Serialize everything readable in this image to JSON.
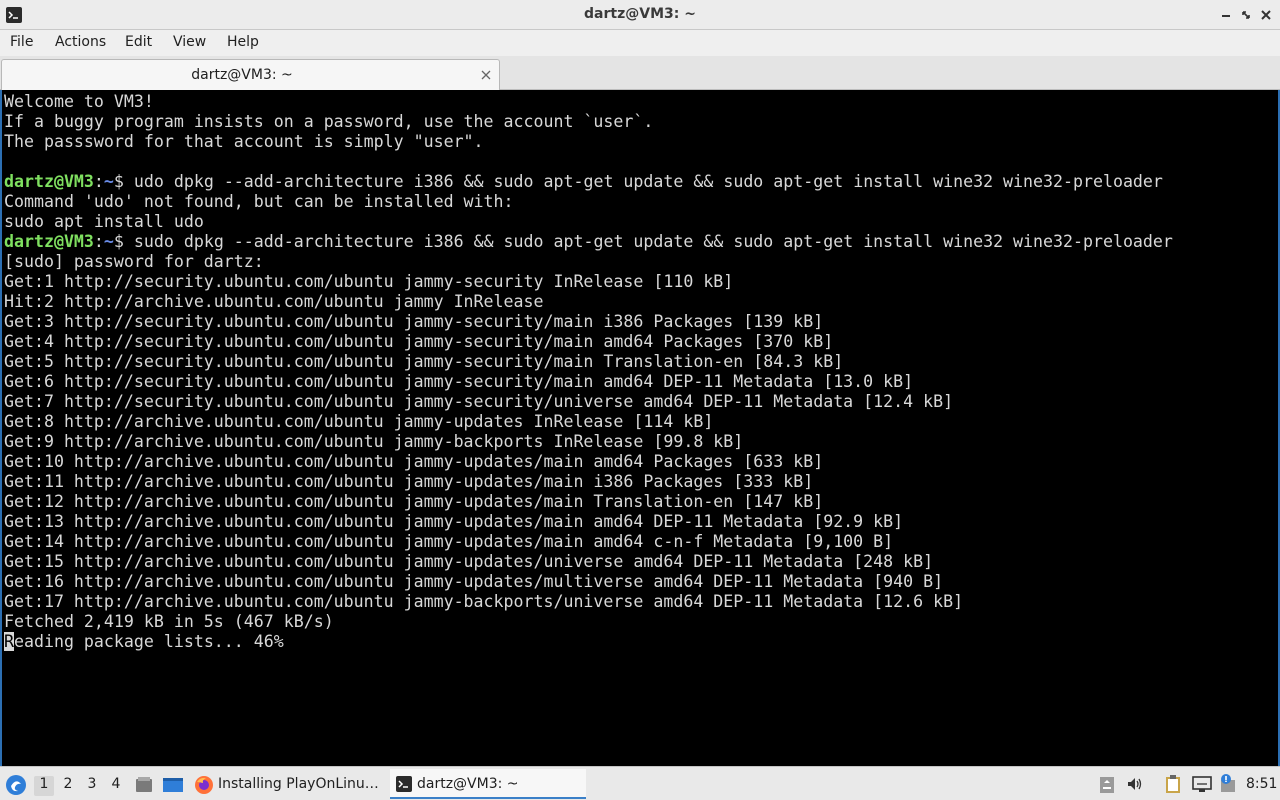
{
  "window": {
    "title": "dartz@VM3: ~",
    "icon": "terminal-icon"
  },
  "menu": {
    "items": [
      "File",
      "Actions",
      "Edit",
      "View",
      "Help"
    ]
  },
  "tabs": [
    {
      "label": "dartz@VM3: ~",
      "close_icon": "close-icon"
    }
  ],
  "terminal": {
    "prompt_user": "dartz@VM3",
    "prompt_sep": ":",
    "prompt_path": "~",
    "prompt_suffix": "$ ",
    "lines": [
      {
        "text": "Welcome to VM3!"
      },
      {
        "text": "If a buggy program insists on a password, use the account `user`."
      },
      {
        "text": "The passsword for that account is simply \"user\"."
      },
      {
        "text": ""
      },
      {
        "prompt": true,
        "text": "udo dpkg --add-architecture i386 && sudo apt-get update && sudo apt-get install wine32 wine32-preloader"
      },
      {
        "text": "Command 'udo' not found, but can be installed with:"
      },
      {
        "text": "sudo apt install udo"
      },
      {
        "prompt": true,
        "text": "sudo dpkg --add-architecture i386 && sudo apt-get update && sudo apt-get install wine32 wine32-preloader"
      },
      {
        "text": "[sudo] password for dartz:"
      },
      {
        "text": "Get:1 http://security.ubuntu.com/ubuntu jammy-security InRelease [110 kB]"
      },
      {
        "text": "Hit:2 http://archive.ubuntu.com/ubuntu jammy InRelease"
      },
      {
        "text": "Get:3 http://security.ubuntu.com/ubuntu jammy-security/main i386 Packages [139 kB]"
      },
      {
        "text": "Get:4 http://security.ubuntu.com/ubuntu jammy-security/main amd64 Packages [370 kB]"
      },
      {
        "text": "Get:5 http://security.ubuntu.com/ubuntu jammy-security/main Translation-en [84.3 kB]"
      },
      {
        "text": "Get:6 http://security.ubuntu.com/ubuntu jammy-security/main amd64 DEP-11 Metadata [13.0 kB]"
      },
      {
        "text": "Get:7 http://security.ubuntu.com/ubuntu jammy-security/universe amd64 DEP-11 Metadata [12.4 kB]"
      },
      {
        "text": "Get:8 http://archive.ubuntu.com/ubuntu jammy-updates InRelease [114 kB]"
      },
      {
        "text": "Get:9 http://archive.ubuntu.com/ubuntu jammy-backports InRelease [99.8 kB]"
      },
      {
        "text": "Get:10 http://archive.ubuntu.com/ubuntu jammy-updates/main amd64 Packages [633 kB]"
      },
      {
        "text": "Get:11 http://archive.ubuntu.com/ubuntu jammy-updates/main i386 Packages [333 kB]"
      },
      {
        "text": "Get:12 http://archive.ubuntu.com/ubuntu jammy-updates/main Translation-en [147 kB]"
      },
      {
        "text": "Get:13 http://archive.ubuntu.com/ubuntu jammy-updates/main amd64 DEP-11 Metadata [92.9 kB]"
      },
      {
        "text": "Get:14 http://archive.ubuntu.com/ubuntu jammy-updates/main amd64 c-n-f Metadata [9,100 B]"
      },
      {
        "text": "Get:15 http://archive.ubuntu.com/ubuntu jammy-updates/universe amd64 DEP-11 Metadata [248 kB]"
      },
      {
        "text": "Get:16 http://archive.ubuntu.com/ubuntu jammy-updates/multiverse amd64 DEP-11 Metadata [940 B]"
      },
      {
        "text": "Get:17 http://archive.ubuntu.com/ubuntu jammy-backports/universe amd64 DEP-11 Metadata [12.6 kB]"
      },
      {
        "text": "Fetched 2,419 kB in 5s (467 kB/s)"
      },
      {
        "cursor": true,
        "text": "Reading package lists... 46%"
      }
    ]
  },
  "taskbar": {
    "start_icon": "start-menu-icon",
    "workspaces": [
      "1",
      "2",
      "3",
      "4"
    ],
    "active_workspace": "1",
    "launchers": [
      "file-manager-icon",
      "show-desktop-icon"
    ],
    "tasks": [
      {
        "label": "Installing PlayOnLinu…",
        "icon": "firefox-icon",
        "active": false
      },
      {
        "label": "dartz@VM3: ~",
        "icon": "terminal-icon",
        "active": true
      }
    ],
    "tray": [
      "removable-drive-icon",
      "volume-icon",
      "clipboard-icon",
      "network-icon",
      "update-notifier-icon"
    ],
    "clock": "8:51"
  },
  "colors": {
    "terminal_bg": "#000000",
    "terminal_fg": "#d8d8d8",
    "prompt_user": "#7fe060",
    "prompt_path": "#6a8ce8",
    "accent": "#2c6fb3"
  }
}
